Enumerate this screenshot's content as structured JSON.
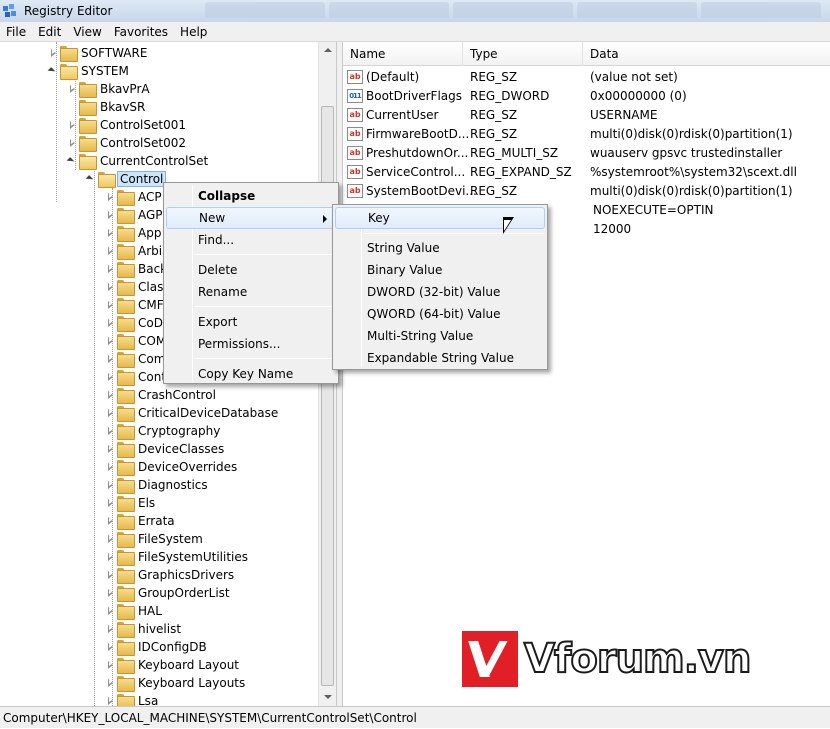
{
  "window": {
    "title": "Registry Editor"
  },
  "menubar": [
    "File",
    "Edit",
    "View",
    "Favorites",
    "Help"
  ],
  "tree": {
    "top_nodes": [
      {
        "label": "SOFTWARE",
        "state": "collapsed"
      },
      {
        "label": "SYSTEM",
        "state": "expanded"
      }
    ],
    "system_children": [
      {
        "label": "BkavPrA",
        "state": "collapsed"
      },
      {
        "label": "BkavSR",
        "state": "leaf"
      },
      {
        "label": "ControlSet001",
        "state": "collapsed"
      },
      {
        "label": "ControlSet002",
        "state": "collapsed"
      },
      {
        "label": "CurrentControlSet",
        "state": "expanded"
      }
    ],
    "selected": "Control",
    "control_children": [
      "ACP",
      "AGP",
      "App",
      "Arbi",
      "Back",
      "Clas",
      "CMF",
      "CoD",
      "COM",
      "Com",
      "Cont",
      "CrashControl",
      "CriticalDeviceDatabase",
      "Cryptography",
      "DeviceClasses",
      "DeviceOverrides",
      "Diagnostics",
      "Els",
      "Errata",
      "FileSystem",
      "FileSystemUtilities",
      "GraphicsDrivers",
      "GroupOrderList",
      "HAL",
      "hivelist",
      "IDConfigDB",
      "Keyboard Layout",
      "Keyboard Layouts",
      "Lsa"
    ]
  },
  "values": {
    "headers": {
      "name": "Name",
      "type": "Type",
      "data": "Data"
    },
    "rows": [
      {
        "icon": "string-value-icon",
        "name": "(Default)",
        "type": "REG_SZ",
        "data": "(value not set)"
      },
      {
        "icon": "binary-value-icon",
        "name": "BootDriverFlags",
        "type": "REG_DWORD",
        "data": "0x00000000 (0)"
      },
      {
        "icon": "string-value-icon",
        "name": "CurrentUser",
        "type": "REG_SZ",
        "data": "USERNAME"
      },
      {
        "icon": "string-value-icon",
        "name": "FirmwareBootD...",
        "type": "REG_SZ",
        "data": "multi(0)disk(0)rdisk(0)partition(1)"
      },
      {
        "icon": "string-value-icon",
        "name": "PreshutdownOr...",
        "type": "REG_MULTI_SZ",
        "data": "wuauserv gpsvc trustedinstaller"
      },
      {
        "icon": "string-value-icon",
        "name": "ServiceControl...",
        "type": "REG_EXPAND_SZ",
        "data": "%systemroot%\\system32\\scext.dll"
      },
      {
        "icon": "string-value-icon",
        "name": "SystemBootDevi...",
        "type": "REG_SZ",
        "data": "multi(0)disk(0)rdisk(0)partition(1)"
      },
      {
        "icon": "",
        "name": "",
        "type": "",
        "data": "NOEXECUTE=OPTIN"
      },
      {
        "icon": "",
        "name": "",
        "type": "",
        "data": "12000"
      }
    ]
  },
  "context_menu": {
    "items": [
      "Collapse",
      "New",
      "Find...",
      "Delete",
      "Rename",
      "Export",
      "Permissions...",
      "Copy Key Name"
    ]
  },
  "submenu": {
    "items": [
      "Key",
      "String Value",
      "Binary Value",
      "DWORD (32-bit) Value",
      "QWORD (64-bit) Value",
      "Multi-String Value",
      "Expandable String Value"
    ]
  },
  "status": "Computer\\HKEY_LOCAL_MACHINE\\SYSTEM\\CurrentControlSet\\Control",
  "watermark": {
    "text": "Vforum.vn"
  },
  "colors": {
    "selection": "#cde5fb",
    "menu_hover": "#dfecfb",
    "logo_red": "#e11f26"
  }
}
